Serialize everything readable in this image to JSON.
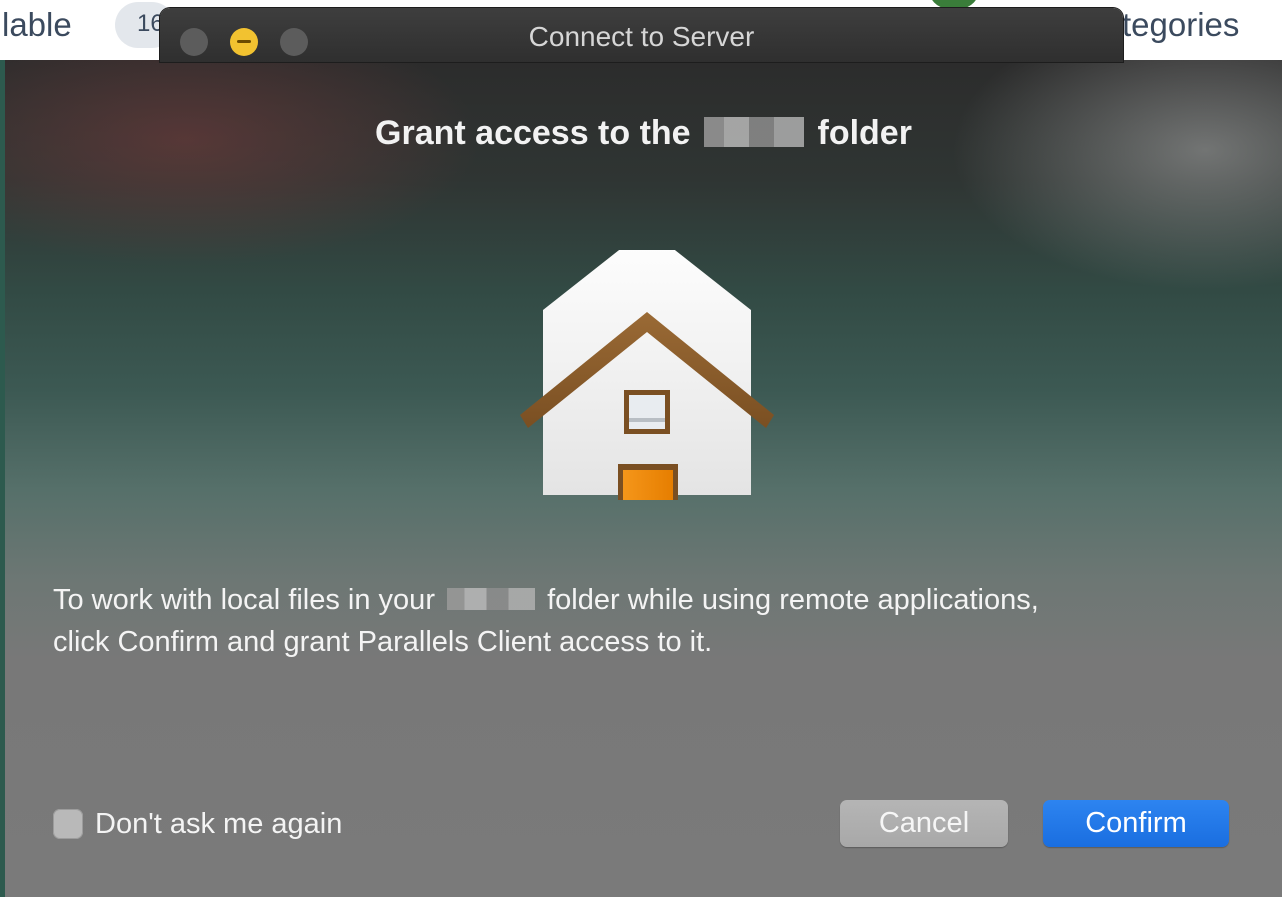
{
  "background": {
    "left_text": "lable",
    "pill_text": "16",
    "right_text": "tegories"
  },
  "window": {
    "title": "Connect to Server",
    "controls": [
      "close",
      "minimize",
      "zoom"
    ]
  },
  "dialog": {
    "title_prefix": "Grant access to the",
    "title_suffix": "folder",
    "icon": "home-folder-icon",
    "body_line1_prefix": "To work with local files in your",
    "body_line1_suffix": "folder while using remote applications,",
    "body_line2": "click Confirm and grant Parallels Client access to it.",
    "checkbox": {
      "label": "Don't ask me again",
      "checked": false
    },
    "buttons": {
      "cancel": "Cancel",
      "confirm": "Confirm"
    }
  },
  "colors": {
    "confirm_button": "#1a6ee0",
    "cancel_button": "#a8a8a8",
    "minimize_light": "#f2c230",
    "roof": "#8a5a2b",
    "door": "#f08a00"
  }
}
